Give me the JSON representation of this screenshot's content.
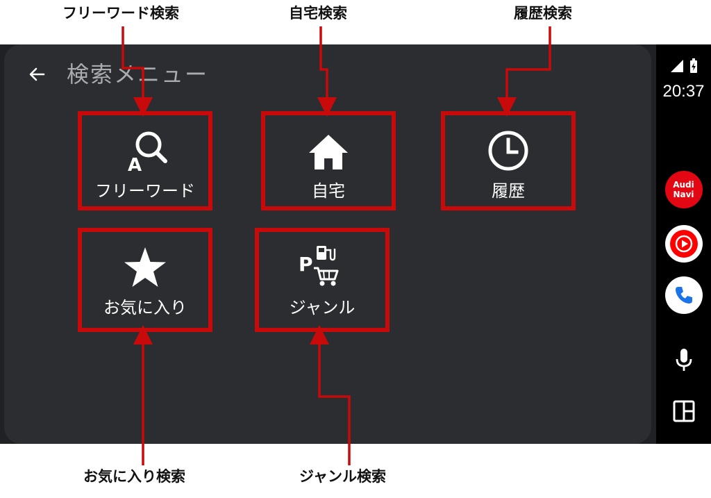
{
  "callouts": {
    "free_word": "フリーワード検索",
    "home": "自宅検索",
    "history": "履歴検索",
    "favorites": "お気に入り検索",
    "genre": "ジャンル検索"
  },
  "header": {
    "back_icon": "arrow-left-icon",
    "title": "検索メニュー"
  },
  "tiles": [
    {
      "label": "フリーワード",
      "icon": "search-a-icon"
    },
    {
      "label": "自宅",
      "icon": "home-icon"
    },
    {
      "label": "履歴",
      "icon": "clock-icon"
    },
    {
      "label": "お気に入り",
      "icon": "star-icon"
    },
    {
      "label": "ジャンル",
      "icon": "genre-poi-icon"
    }
  ],
  "status": {
    "time": "20:37",
    "signal_icon": "signal-icon",
    "battery_icon": "battery-charging-icon"
  },
  "rail": {
    "audi_navi": "Audi\nNavi",
    "apps": [
      "audi-navi",
      "youtube-music-icon",
      "phone-icon"
    ],
    "mic_icon": "mic-icon",
    "dashboard_icon": "dashboard-grid-icon"
  },
  "colors": {
    "highlight": "#c80a0a",
    "panel": "#2c2d30",
    "rail": "#000000",
    "audi_red": "#e30613",
    "yt_red": "#ff0000",
    "phone_blue": "#1a73e8"
  }
}
